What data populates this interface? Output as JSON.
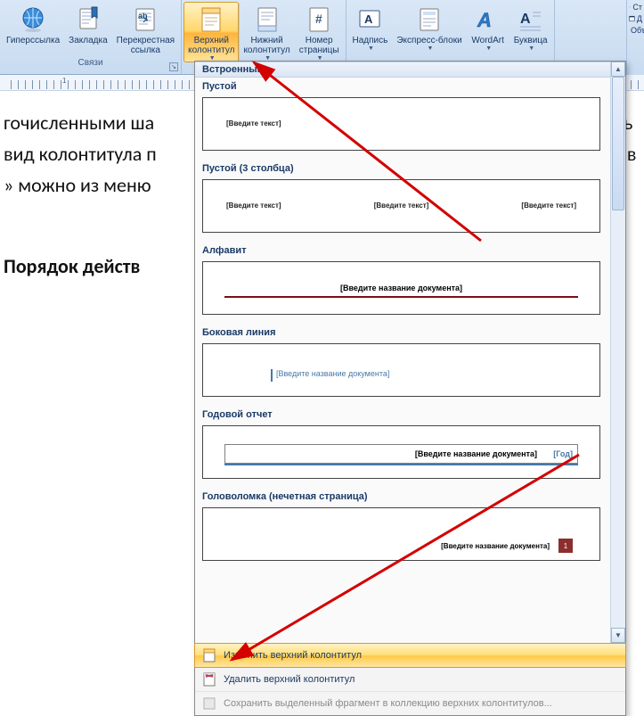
{
  "ribbon": {
    "groups": {
      "links": {
        "label": "Связи",
        "hyperlink": "Гиперссылка",
        "bookmark": "Закладка",
        "crossref": "Перекрестная\nссылка"
      },
      "header_footer": {
        "header": "Верхний\nколонтитул",
        "footer": "Нижний\nколонтитул",
        "page_number": "Номер\nстраницы"
      },
      "text": {
        "textbox": "Надпись",
        "quickparts": "Экспресс-блоки",
        "wordart": "WordArt",
        "dropcap": "Буквица"
      },
      "side": {
        "signature": "Ст",
        "date": "Д",
        "object": "Объ"
      }
    }
  },
  "ruler": {
    "num1": "1"
  },
  "document": {
    "line1": "гочисленными ша",
    "line2": "вид колонтитула п",
    "line3": "» можно из меню",
    "heading": "Порядок действ",
    "r1": "ать",
    "r2": "лов"
  },
  "gallery": {
    "section_builtin": "Встроенный",
    "items": [
      {
        "name": "Пустой",
        "type": "blank",
        "placeholders": [
          "[Введите текст]"
        ]
      },
      {
        "name": "Пустой (3 столбца)",
        "type": "blank3",
        "placeholders": [
          "[Введите текст]",
          "[Введите текст]",
          "[Введите текст]"
        ]
      },
      {
        "name": "Алфавит",
        "type": "alpha",
        "title": "[Введите название документа]"
      },
      {
        "name": "Боковая линия",
        "type": "side",
        "title": "[Введите название документа]"
      },
      {
        "name": "Годовой отчет",
        "type": "annual",
        "title": "[Введите название документа]",
        "year": "[Год]"
      },
      {
        "name": "Головоломка (нечетная страница)",
        "type": "puzzle",
        "title": "[Введите название документа]",
        "page": "1"
      }
    ],
    "actions": {
      "edit": "Изменить верхний колонтитул",
      "remove": "Удалить верхний колонтитул",
      "save": "Сохранить выделенный фрагмент в коллекцию верхних колонтитулов..."
    }
  }
}
